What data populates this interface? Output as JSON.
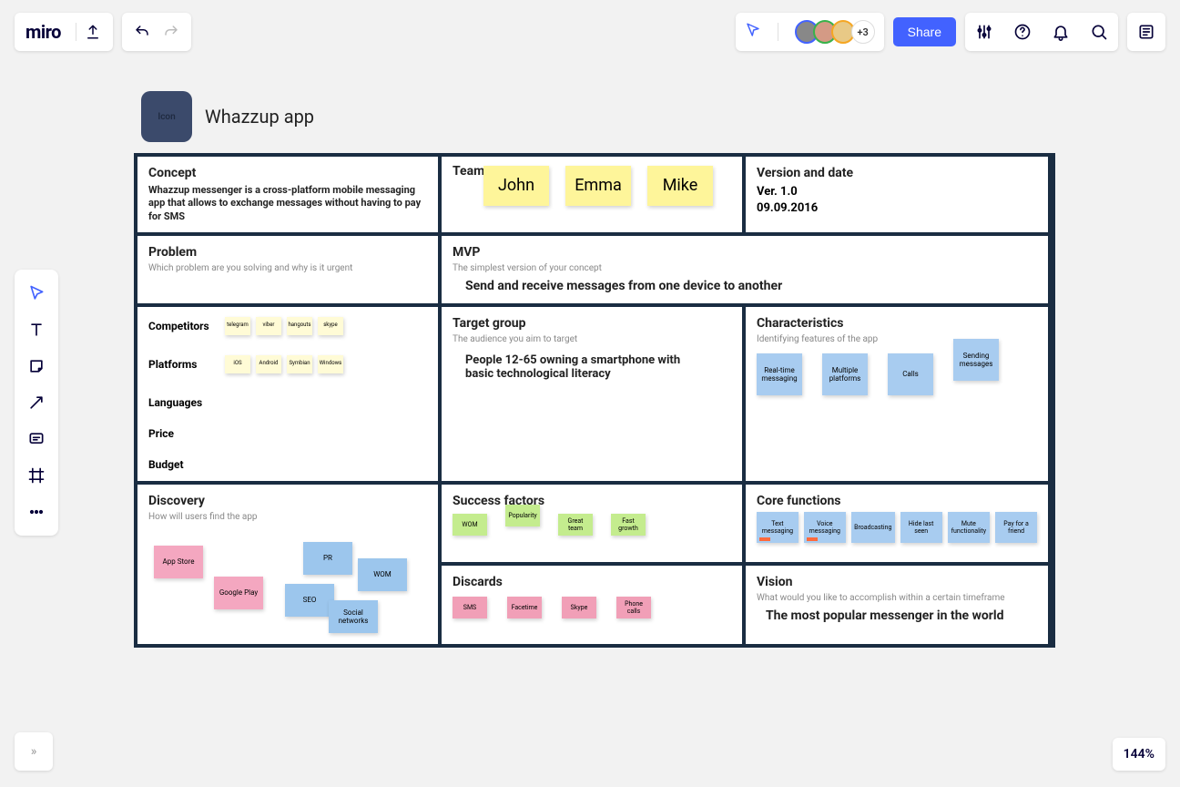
{
  "app": {
    "name": "miro"
  },
  "toolbar": {
    "share": "Share",
    "more_avatars": "+3"
  },
  "zoom": "144%",
  "board": {
    "icon_label": "Icon",
    "title": "Whazzup app"
  },
  "concept": {
    "title": "Concept",
    "body": "Whazzup messenger is a cross-platform mobile messaging app that allows to exchange messages without having to pay for SMS"
  },
  "team": {
    "title": "Team",
    "members": [
      "John",
      "Emma",
      "Mike"
    ]
  },
  "version": {
    "title": "Version and date",
    "ver": "Ver. 1.0",
    "date": "09.09.2016"
  },
  "problem": {
    "title": "Problem",
    "sub": "Which problem are you solving and why is it urgent"
  },
  "mvp": {
    "title": "MVP",
    "sub": "The simplest version of your concept",
    "body": "Send and receive messages from one device to another"
  },
  "competitors": {
    "title": "Competitors",
    "row1": [
      "telegram",
      "viber",
      "hangouts",
      "skype"
    ],
    "platforms_title": "Platforms",
    "row2": [
      "iOS",
      "Android",
      "Symbian",
      "Windows"
    ],
    "languages_title": "Languages",
    "price_title": "Price",
    "budget_title": "Budget"
  },
  "target": {
    "title": "Target group",
    "sub": "The audience you aim to target",
    "body": "People 12-65 owning a smartphone with basic technological literacy"
  },
  "characteristics": {
    "title": "Characteristics",
    "sub": "Identifying features of the app",
    "items": [
      "Real-time messaging",
      "Multiple platforms",
      "Calls",
      "Sending messages"
    ]
  },
  "discovery": {
    "title": "Discovery",
    "sub": "How will users find the app",
    "items": [
      "App Store",
      "Google Play",
      "SEO",
      "PR",
      "Social networks",
      "WOM"
    ]
  },
  "success": {
    "title": "Success factors",
    "items": [
      "WOM",
      "Popularity",
      "Great team",
      "Fast growth"
    ]
  },
  "core": {
    "title": "Core functions",
    "items": [
      "Text messaging",
      "Voice messaging",
      "Broadcasting",
      "Hide last seen",
      "Mute functionality",
      "Pay for a friend"
    ]
  },
  "discards": {
    "title": "Discards",
    "items": [
      "SMS",
      "Facetime",
      "Skype",
      "Phone calls"
    ]
  },
  "vision": {
    "title": "Vision",
    "sub": "What would you like to accomplish within a certain timeframe",
    "body": "The most popular messenger in the world"
  }
}
